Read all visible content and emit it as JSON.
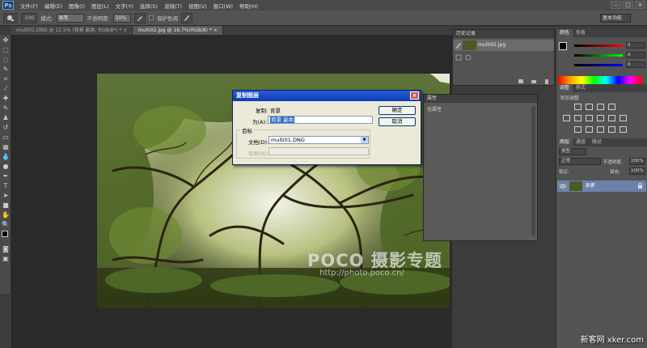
{
  "menubar": {
    "logo": "Ps",
    "items": [
      "文件(F)",
      "编辑(E)",
      "图像(I)",
      "图层(L)",
      "文字(Y)",
      "选择(S)",
      "滤镜(T)",
      "视图(V)",
      "窗口(W)",
      "帮助(H)"
    ],
    "minimize": "–",
    "maximize": "□",
    "close": "×"
  },
  "options": {
    "size_value": "100",
    "mode_label": "模式:",
    "mode_value": "画笔",
    "opacity_label": "不透明度:",
    "opacity_value": "50%",
    "protect_label": "保护色调",
    "workspace": "基本功能"
  },
  "tabs": [
    {
      "label": "multi01.DNG @ 12.5% (背景 副本, RGB/8*) *  ×"
    },
    {
      "label": "multi02.jpg @ 16.7%(RGB/8) *  ×"
    }
  ],
  "dialog": {
    "title": "复制图层",
    "copy_label": "复制:",
    "copy_value": "背景",
    "as_label": "为(A):",
    "as_value": "背景 副本",
    "ok": "确定",
    "cancel": "取消",
    "group_title": "目标",
    "document_label": "文档(D):",
    "document_value": "multi01.DNG",
    "name_label": "名称(N):",
    "close": "×"
  },
  "history": {
    "title": "历史记录",
    "item": "multi02.jpg"
  },
  "properties": {
    "title": "属性",
    "empty": "无属性"
  },
  "color_panel": {
    "tabs": [
      "颜色",
      "色板"
    ],
    "values": [
      "0",
      "0",
      "0"
    ]
  },
  "adjust_panel": {
    "tabs": [
      "调整",
      "样式"
    ],
    "title": "添加调整"
  },
  "layers_panel": {
    "tabs": [
      "图层",
      "通道",
      "路径"
    ],
    "kind": "类型",
    "blend": "正常",
    "opacity_label": "不透明度:",
    "opacity_value": "100%",
    "lock_label": "锁定:",
    "fill_label": "填充:",
    "fill_value": "100%",
    "layer_name": "背景"
  },
  "watermark": {
    "poco": "POCO 摄影专题",
    "url": "http://photo.poco.cn/"
  },
  "site_mark": "新客网 xker.com"
}
